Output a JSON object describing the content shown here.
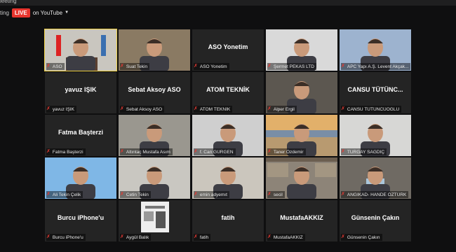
{
  "window": {
    "title": "leeting"
  },
  "stream": {
    "prefix": "ting",
    "live_badge": "LIVE",
    "platform": "on YouTube"
  },
  "tiles": [
    {
      "name": "ASO",
      "center": "",
      "video": "office-flags"
    },
    {
      "name": "Suat Tekin",
      "center": "",
      "video": "man-beard"
    },
    {
      "name": "ASO Yonetim",
      "center": "ASO Yonetim",
      "video": ""
    },
    {
      "name": "Şermet PEKAS LTD",
      "center": "",
      "video": "man-glasses"
    },
    {
      "name": "APC Yapı A.Ş. Levent Akçak...",
      "center": "",
      "video": "man-outdoor"
    },
    {
      "name": "yavuz IŞIK",
      "center": "yavuz IŞIK",
      "video": ""
    },
    {
      "name": "Sebat Aksoy ASO",
      "center": "Sebat Aksoy ASO",
      "video": ""
    },
    {
      "name": "ATOM TEKNİK",
      "center": "ATOM TEKNİK",
      "video": ""
    },
    {
      "name": "Alper Ergil",
      "center": "",
      "video": "man-dark"
    },
    {
      "name": "CANSU TÜTÜNCÜOĞLU",
      "center": "CANSU TÜTÜNC...",
      "video": ""
    },
    {
      "name": "Fatma Başterzi",
      "center": "Fatma Başterzi",
      "video": ""
    },
    {
      "name": "Altıntaç Mustafa Asım",
      "center": "",
      "video": "man-room"
    },
    {
      "name": "f. Can GÜRGEN",
      "center": "",
      "video": "man-bright"
    },
    {
      "name": "Taner Özdemir",
      "center": "",
      "video": "man-sunset"
    },
    {
      "name": "TURGAY SAĞDIÇ",
      "center": "",
      "video": "man-light"
    },
    {
      "name": "Ali Tekin Çelik",
      "center": "",
      "video": "man-blue"
    },
    {
      "name": "Cetin Tekin",
      "center": "",
      "video": "man-grey"
    },
    {
      "name": "emin adyemıt",
      "center": "",
      "video": "man-bald"
    },
    {
      "name": "secil",
      "center": "",
      "video": "woman-shelf"
    },
    {
      "name": "ANGIKAD- HANDE ÖZTÜRK",
      "center": "",
      "video": "woman-mask"
    },
    {
      "name": "Burcu iPhone'u",
      "center": "Burcu iPhone'u",
      "video": ""
    },
    {
      "name": "Aygül Balık",
      "center": "",
      "video": "poster"
    },
    {
      "name": "fatih",
      "center": "fatih",
      "video": ""
    },
    {
      "name": "MustafaAKKIZ",
      "center": "MustafaAKKIZ",
      "video": ""
    },
    {
      "name": "Günsenin Çakın",
      "center": "Günsenin Çakın",
      "video": ""
    }
  ],
  "icons": {
    "mic_muted": "mic-muted-icon",
    "dropdown": "chevron-down-icon"
  }
}
